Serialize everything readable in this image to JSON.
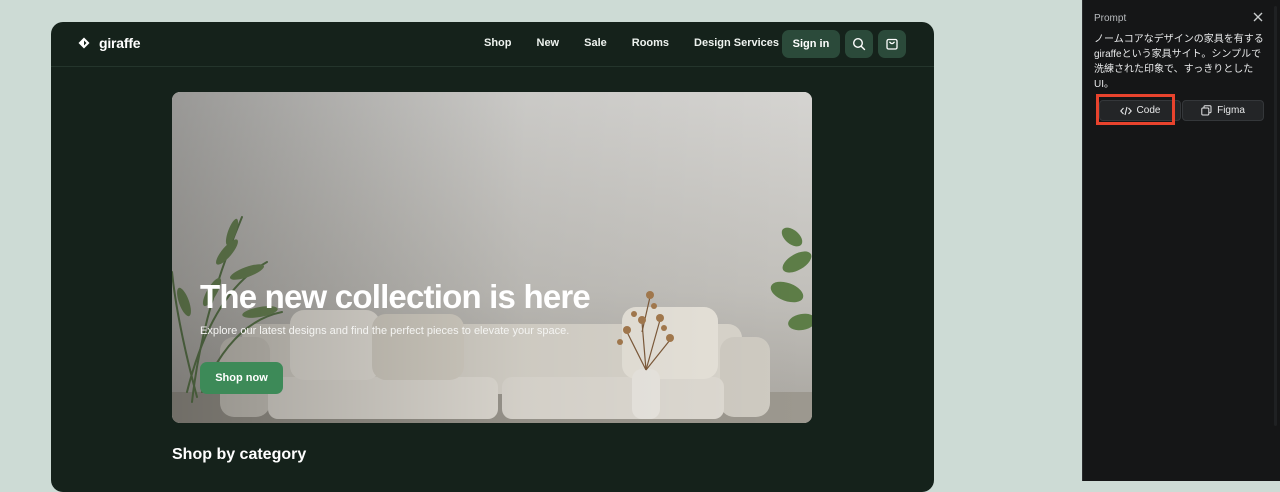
{
  "site": {
    "brand": "giraffe",
    "nav": [
      "Shop",
      "New",
      "Sale",
      "Rooms",
      "Design Services"
    ],
    "sign_in_label": "Sign in",
    "hero": {
      "title": "The new collection is here",
      "subtitle": "Explore our latest designs and find the perfect pieces to elevate your space.",
      "cta_label": "Shop now"
    },
    "section_title": "Shop by category"
  },
  "panel": {
    "title": "Prompt",
    "prompt_text": "ノームコアなデザインの家具を有するgiraffeという家具サイト。シンプルで洗練された印象で、すっきりとしたUI。",
    "code_label": "Code",
    "figma_label": "Figma"
  },
  "icons": {
    "brand": "diamond-logo-icon",
    "search": "search-icon",
    "cart": "bag-icon",
    "close": "close-icon",
    "code": "code-icon",
    "figma": "copy-icon"
  },
  "colors": {
    "page_bg": "#cddbd5",
    "site_bg": "#15221b",
    "accent_dark": "#2b4a3a",
    "cta": "#3d8a58",
    "panel_bg": "#151617",
    "highlight": "#e8432d"
  }
}
